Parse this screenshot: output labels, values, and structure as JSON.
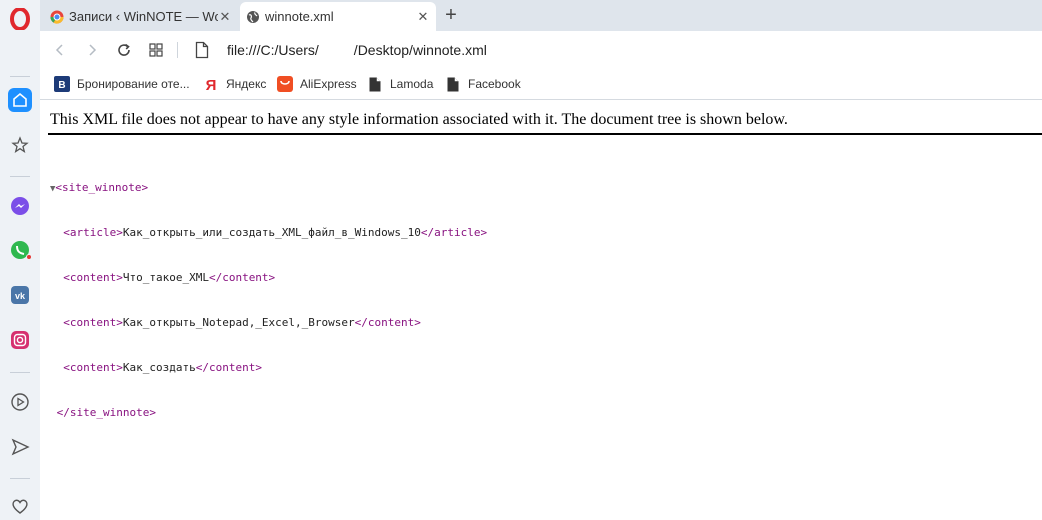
{
  "tabs": [
    {
      "title": "Записи ‹ WinNOTE — Wor",
      "favicon": "chrome-like-icon",
      "active": false
    },
    {
      "title": "winnote.xml",
      "favicon": "globe-icon",
      "active": true
    }
  ],
  "address": {
    "url": "file:///C:/Users/         /Desktop/winnote.xml"
  },
  "bookmarks": [
    {
      "label": "Бронирование оте...",
      "icon": "booking-icon"
    },
    {
      "label": "Яндекс",
      "icon": "yandex-icon"
    },
    {
      "label": "AliExpress",
      "icon": "aliexpress-icon"
    },
    {
      "label": "Lamoda",
      "icon": "file-icon"
    },
    {
      "label": "Facebook",
      "icon": "file-icon"
    }
  ],
  "sidebar": {
    "items": [
      "home-icon",
      "star-icon",
      "messenger-icon",
      "whatsapp-icon",
      "vk-icon",
      "instagram-icon",
      "player-icon",
      "send-icon",
      "heart-icon"
    ]
  },
  "page": {
    "info": "This XML file does not appear to have any style information associated with it. The document tree is shown below.",
    "toggle": "▼",
    "root_open": "<site_winnote>",
    "root_close": "</site_winnote>",
    "nodes": [
      {
        "open": "<article>",
        "text": "Как_открыть_или_создать_XML_файл_в_Windows_10",
        "close": "</article>"
      },
      {
        "open": "<content>",
        "text": "Что_такое_XML",
        "close": "</content>"
      },
      {
        "open": "<content>",
        "text": "Как_открыть_Notepad,_Excel,_Browser",
        "close": "</content>"
      },
      {
        "open": "<content>",
        "text": "Как_создать",
        "close": "</content>"
      }
    ]
  },
  "colors": {
    "accent": "#1e90ff",
    "tag": "#881280",
    "opera_red": "#e0282d"
  }
}
